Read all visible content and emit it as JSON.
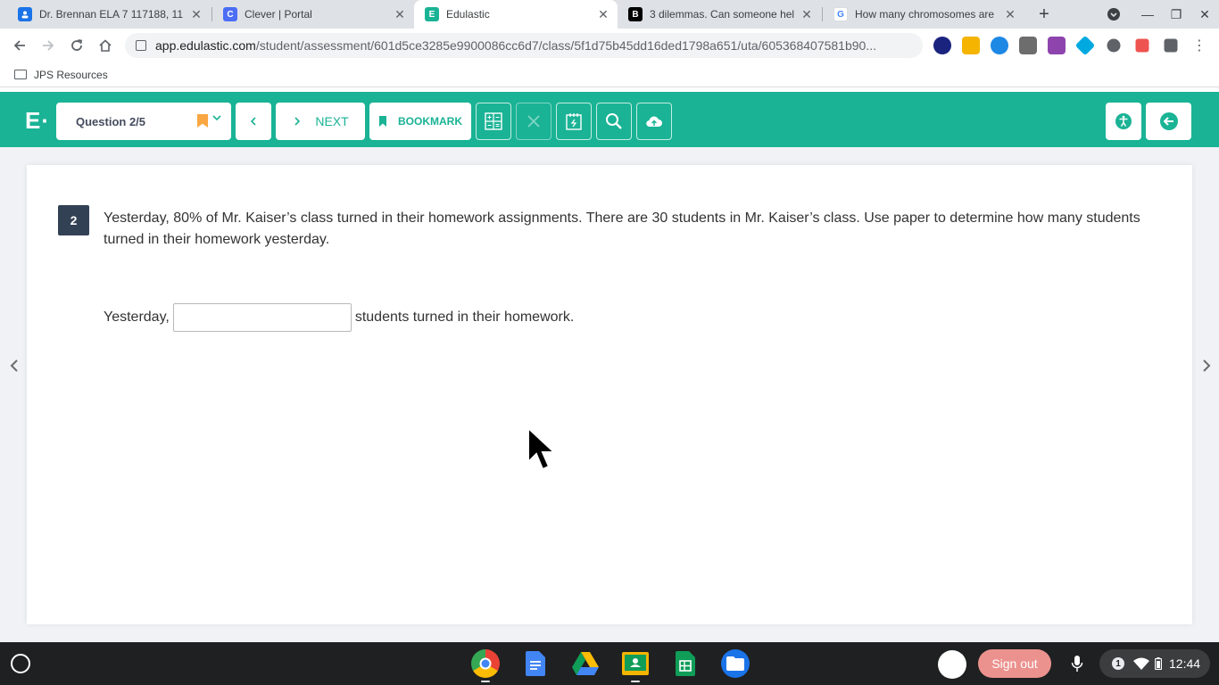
{
  "browser": {
    "tabs": [
      {
        "title": "Dr. Brennan ELA 7 117188, 11",
        "favicon": "google-classroom-person-icon",
        "color": "#1a73e8",
        "glyph": "",
        "active": false
      },
      {
        "title": "Clever | Portal",
        "favicon": "clever-icon",
        "color": "#4c6ef5",
        "glyph": "C",
        "active": false
      },
      {
        "title": "Edulastic",
        "favicon": "edulastic-icon",
        "color": "#1ab395",
        "glyph": "E",
        "active": true
      },
      {
        "title": "3 dilemmas. Can someone hel",
        "favicon": "brainly-icon",
        "color": "#000000",
        "glyph": "B",
        "active": false
      },
      {
        "title": "How many chromosomes are",
        "favicon": "google-icon",
        "color": "#4285f4",
        "glyph": "G",
        "active": false
      }
    ],
    "url_host": "app.edulastic.com",
    "url_path": "/student/assessment/601d5ce3285e9900086cc6d7/class/5f1d75b45dd16ded1798a651/uta/605368407581b90...",
    "bookmark_folder": "JPS Resources"
  },
  "app": {
    "question_selector": "Question 2/5",
    "next_label": "NEXT",
    "bookmark_label": "BOOKMARK",
    "colors": {
      "brand": "#1ab395",
      "bookmark_flag": "#f9a743",
      "question_badge": "#334155"
    }
  },
  "question": {
    "number": "2",
    "text": "Yesterday, 80% of Mr. Kaiser’s class turned in their homework assignments.  There are 30 students in Mr. Kaiser’s class.  Use paper to determine how many students turned in their homework yesterday.",
    "answer_prefix": "Yesterday,",
    "answer_value": "",
    "answer_suffix": "students turned in their homework."
  },
  "shelf": {
    "sign_out_label": "Sign out",
    "notification_count": "1",
    "time": "12:44"
  }
}
